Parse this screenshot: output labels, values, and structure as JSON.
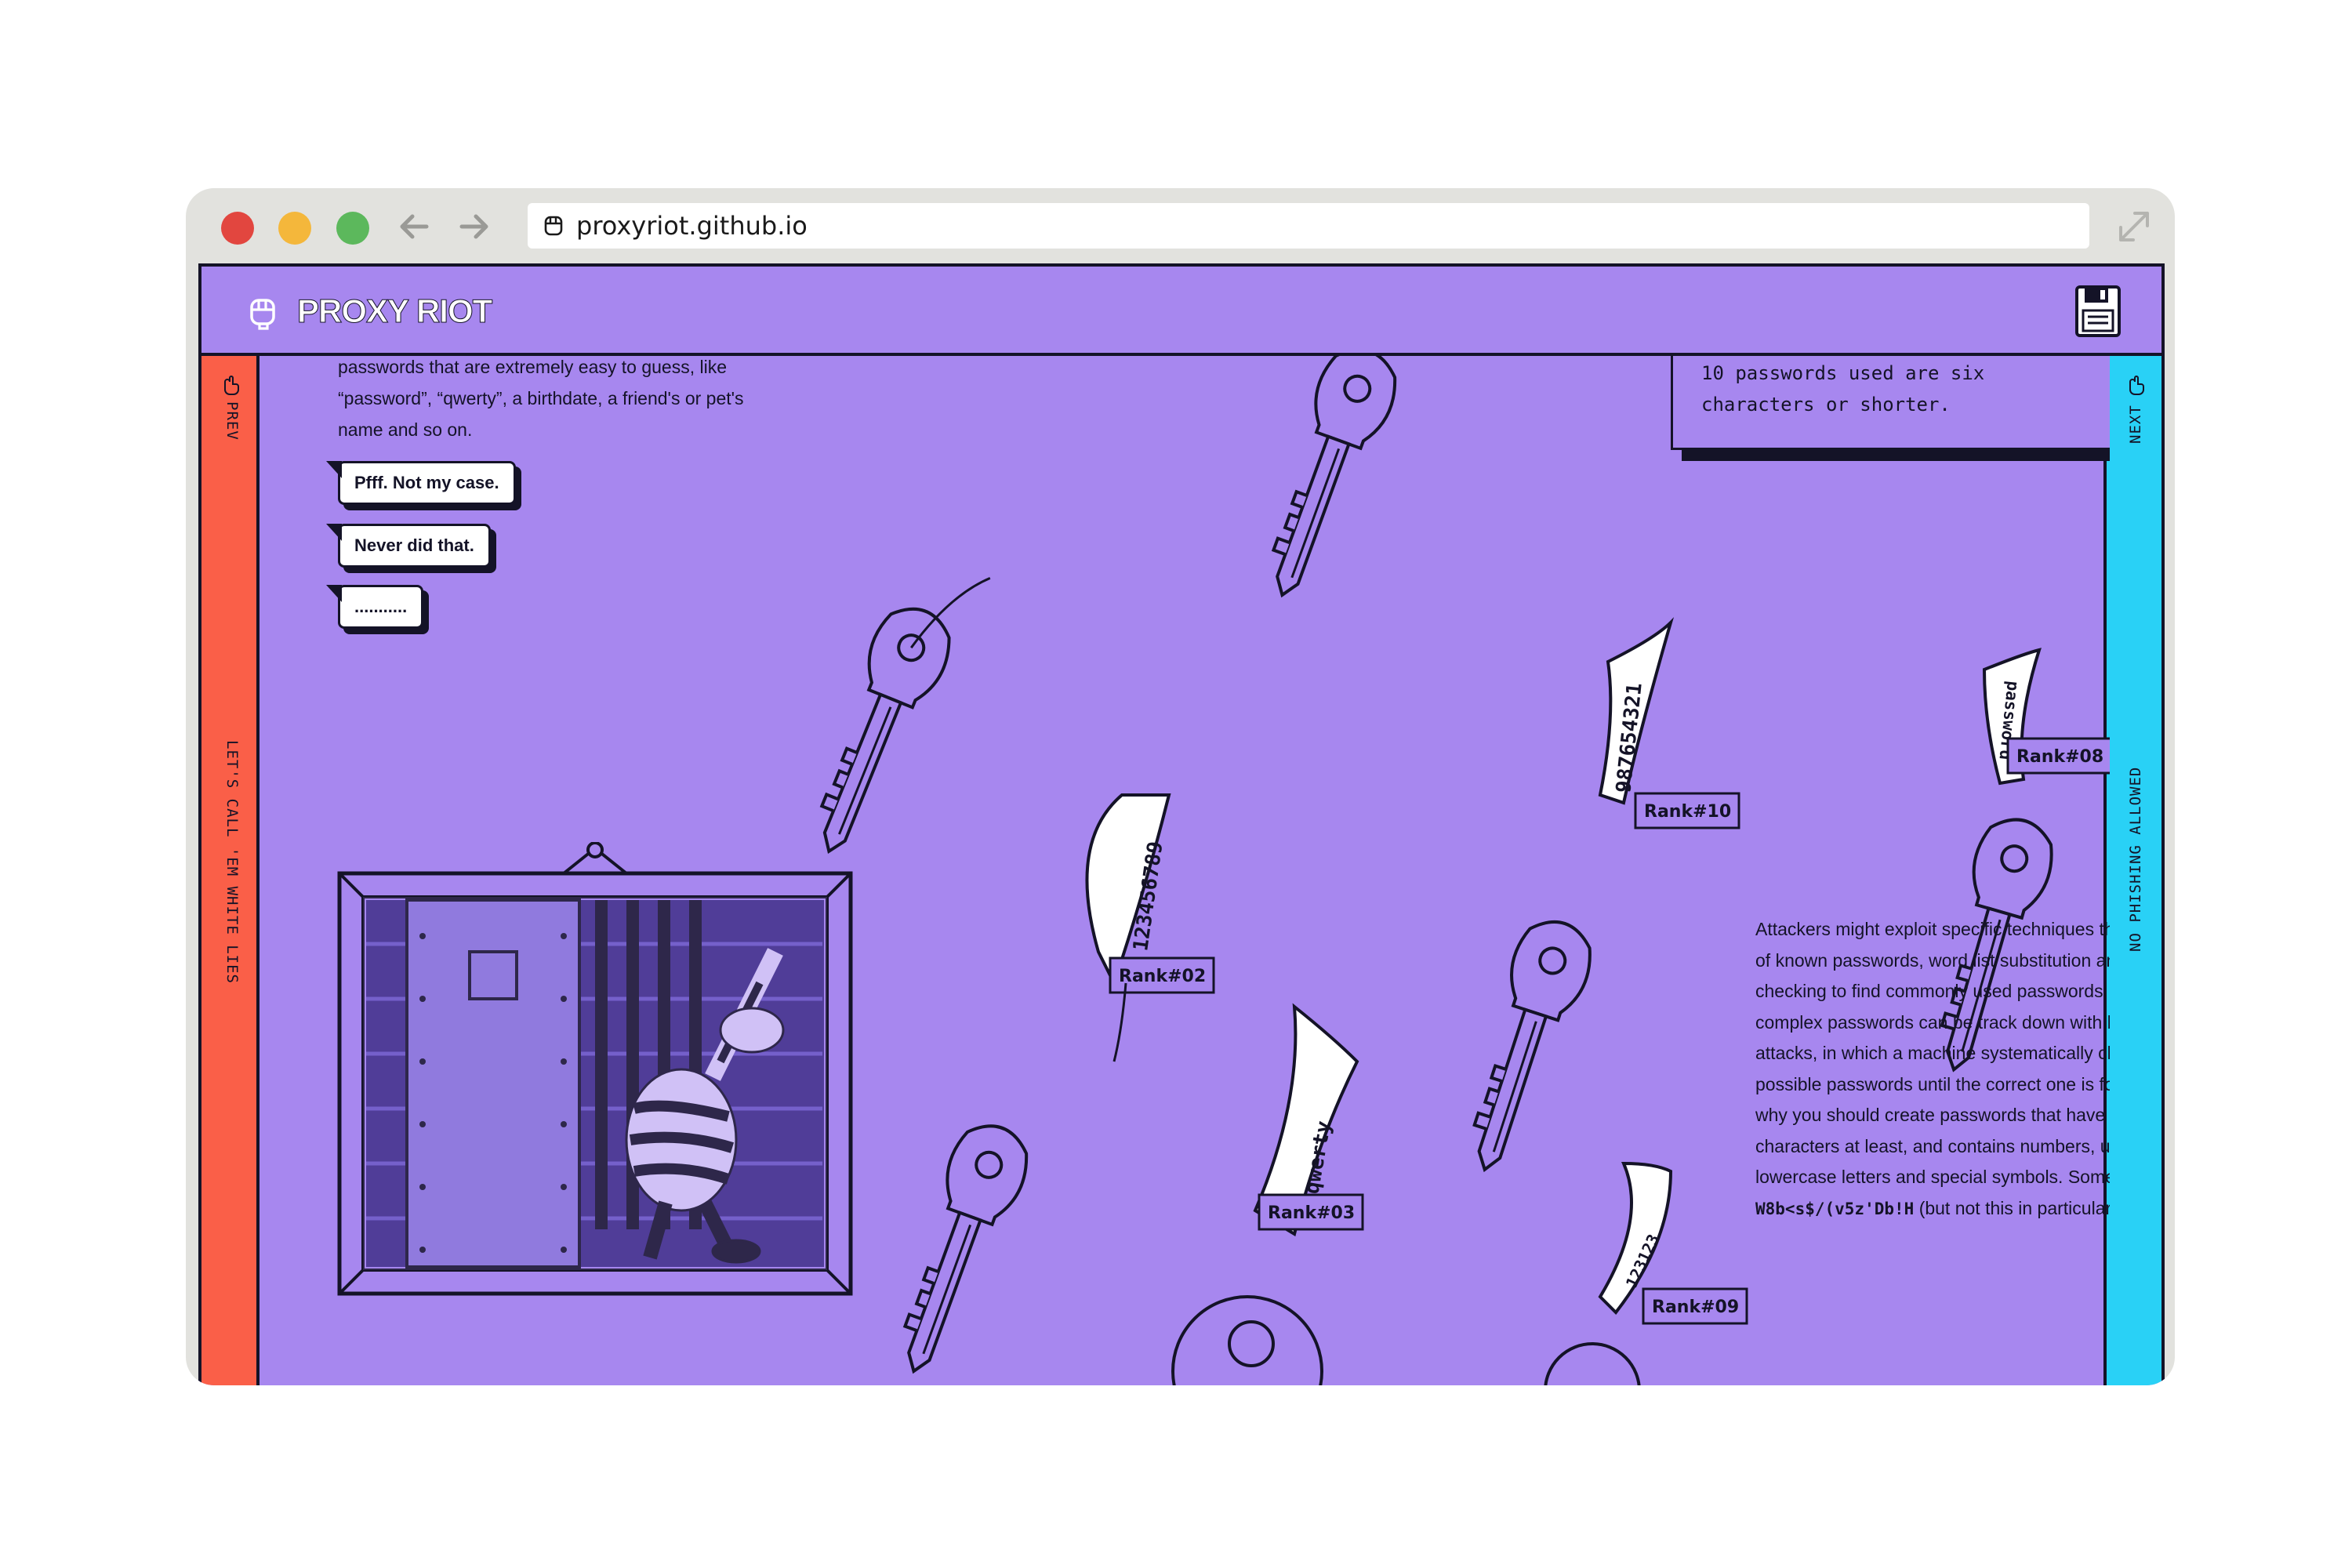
{
  "browser": {
    "url": "proxyriot.github.io"
  },
  "site": {
    "brand": "PROXY RIOT",
    "left_rail": {
      "nav_label": "PREV",
      "section_label": "LET'S CALL 'EM WHITE LIES"
    },
    "right_rail": {
      "nav_label": "NEXT",
      "section_label": "NO PHISHING ALLOWED"
    },
    "intro_text": "passwords that are extremely easy to guess, like “password”, “qwerty”, a birthdate, a friend's or pet's name and so on.",
    "bubbles": [
      "Pfff. Not my case.",
      "Never did that.",
      "..........."
    ],
    "stat_text": "10 passwords used are six\ncharacters or shorter.",
    "keys": [
      {
        "tag": "123456789",
        "rank": "Rank#02"
      },
      {
        "tag": "qwerty",
        "rank": "Rank#03"
      },
      {
        "tag": "password",
        "rank": "Rank#08"
      },
      {
        "tag": "123123",
        "rank": "Rank#09"
      },
      {
        "tag": "987654321",
        "rank": "Rank#10"
      }
    ],
    "body_text": "Attackers might exploit specific techniques that employ lists of known passwords, word list substitution and pattern checking to find commonly used passwords. Even more complex passwords can be track down with brute force attacks, in which a machine systematically checks all possible passwords until the correct one is found. That's why you should create passwords that have 12-16 characters at least, and contains numbers, uppercase and lowercase letters and special symbols. Something like this:",
    "password_example": "W8b<s$/(v5z'Db!H",
    "password_note": "(but not this in particular!",
    "password_note_end": ")"
  },
  "colors": {
    "background": "#a787ef",
    "left_rail": "#fa5f48",
    "right_rail": "#29d1f6",
    "ink": "#141327",
    "frame": "#a787ef",
    "browser_chrome": "#e2e2de"
  }
}
